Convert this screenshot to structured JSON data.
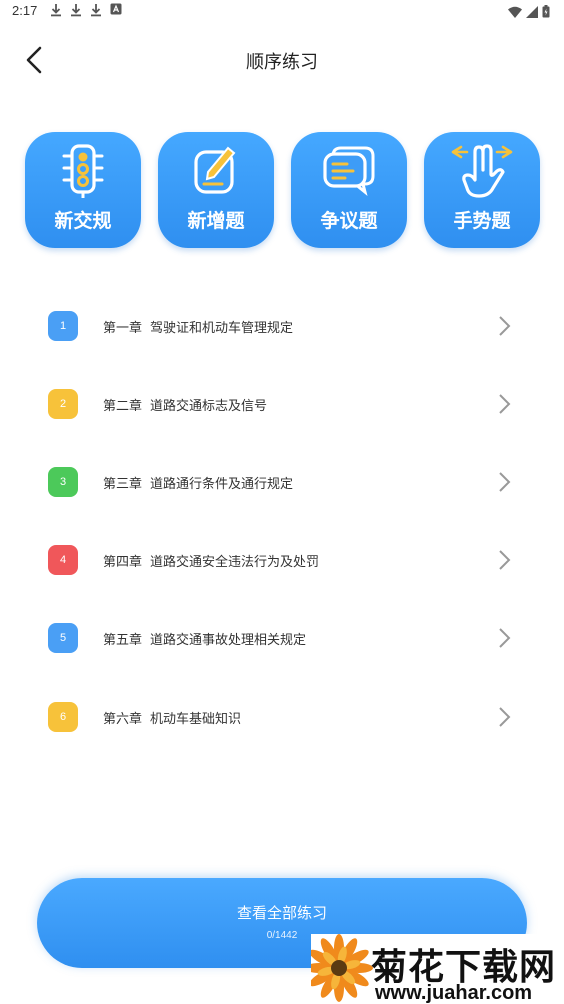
{
  "status_bar": {
    "time": "2:17"
  },
  "header": {
    "title": "顺序练习"
  },
  "features": [
    {
      "label": "新交规",
      "icon": "traffic-light-icon"
    },
    {
      "label": "新增题",
      "icon": "edit-note-icon"
    },
    {
      "label": "争议题",
      "icon": "chat-bubbles-icon"
    },
    {
      "label": "手势题",
      "icon": "hand-gesture-icon"
    }
  ],
  "chapters": [
    {
      "badge": "1",
      "chapter": "第一章",
      "title": "驾驶证和机动车管理规定",
      "color": "#4a9ff5"
    },
    {
      "badge": "2",
      "chapter": "第二章",
      "title": "道路交通标志及信号",
      "color": "#f7c23a"
    },
    {
      "badge": "3",
      "chapter": "第三章",
      "title": "道路通行条件及通行规定",
      "color": "#4cc95a"
    },
    {
      "badge": "4",
      "chapter": "第四章",
      "title": "道路交通安全违法行为及处罚",
      "color": "#f0575a"
    },
    {
      "badge": "5",
      "chapter": "第五章",
      "title": "道路交通事故处理相关规定",
      "color": "#4a9ff5"
    },
    {
      "badge": "6",
      "chapter": "第六章",
      "title": "机动车基础知识",
      "color": "#f7c23a"
    }
  ],
  "bottom_button": {
    "label": "查看全部练习",
    "progress": "0/1442"
  },
  "watermark": {
    "title": "菊花下载网",
    "url": "www.juahar.com"
  }
}
